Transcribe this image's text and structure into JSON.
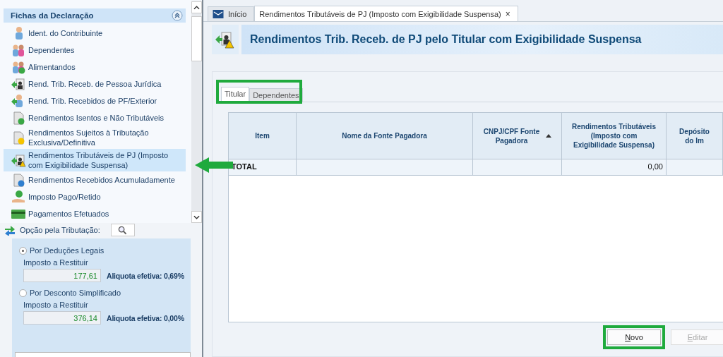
{
  "sidebar": {
    "title": "Fichas da Declaração",
    "items": [
      {
        "label": "Ident. do Contribuinte",
        "kind": "person",
        "selected": false
      },
      {
        "label": "Dependentes",
        "kind": "people",
        "selected": false
      },
      {
        "label": "Alimentandos",
        "kind": "people-add",
        "selected": false
      },
      {
        "label": "Rend. Trib. Receb. de Pessoa Jurídica",
        "kind": "arrow-badge",
        "selected": false
      },
      {
        "label": "Rend. Trib. Recebidos de PF/Exterior",
        "kind": "arrow-person",
        "selected": false
      },
      {
        "label": "Rendimentos Isentos e Não Tributáveis",
        "kind": "doc-check",
        "selected": false
      },
      {
        "label": "Rendimentos Sujeitos à Tributação Exclusiva/Definitiva",
        "kind": "doc-warn",
        "selected": false
      },
      {
        "label": "Rendimentos Tributáveis de PJ (Imposto com Exigibilidade Suspensa)",
        "kind": "arrow-warn",
        "selected": true
      },
      {
        "label": "Rendimentos Recebidos Acumuladamente",
        "kind": "doc-back",
        "selected": false
      },
      {
        "label": "Imposto Pago/Retido",
        "kind": "money",
        "selected": false
      },
      {
        "label": "Pagamentos Efetuados",
        "kind": "card",
        "selected": false
      }
    ]
  },
  "tax_option": {
    "label": "Opção pela Tributação:",
    "options": [
      {
        "label": "Por Deduções Legais",
        "selected": true,
        "field_label": "Imposto a Restituir",
        "value": "177,61",
        "rate": "Aliquota efetiva: 0,69%"
      },
      {
        "label": "Por Desconto Simplificado",
        "selected": false,
        "field_label": "Imposto a Restituir",
        "value": "376,14",
        "rate": "Aliquota efetiva: 0,00%"
      }
    ]
  },
  "tabs": [
    {
      "label": "Início",
      "kind": "home",
      "selected": false
    },
    {
      "label": "Rendimentos Tributáveis de PJ (Imposto com Exigibilidade Suspensa)",
      "kind": "page",
      "selected": true,
      "close": "×"
    }
  ],
  "page_title": "Rendimentos Trib. Receb. de PJ pelo Titular com Exigibilidade Suspensa",
  "subtabs": [
    {
      "label": "Titular",
      "selected": true
    },
    {
      "label": "Dependentes",
      "selected": false
    }
  ],
  "table": {
    "columns": [
      {
        "label": "Item",
        "sorted": false
      },
      {
        "label": "Nome da Fonte Pagadora",
        "sorted": false
      },
      {
        "label": "CNPJ/CPF Fonte Pagadora",
        "sorted": true
      },
      {
        "label": "Rendimentos Tributáveis (Imposto com Exigibilidade Suspensa)",
        "sorted": false
      },
      {
        "label": "Depósito do Im",
        "sorted": false
      }
    ],
    "total_row": {
      "label": "TOTAL",
      "amount": "0,00"
    }
  },
  "buttons": [
    {
      "label": "Novo",
      "disabled": false,
      "highlighted": true
    },
    {
      "label": "Editar",
      "disabled": true,
      "highlighted": false
    }
  ]
}
